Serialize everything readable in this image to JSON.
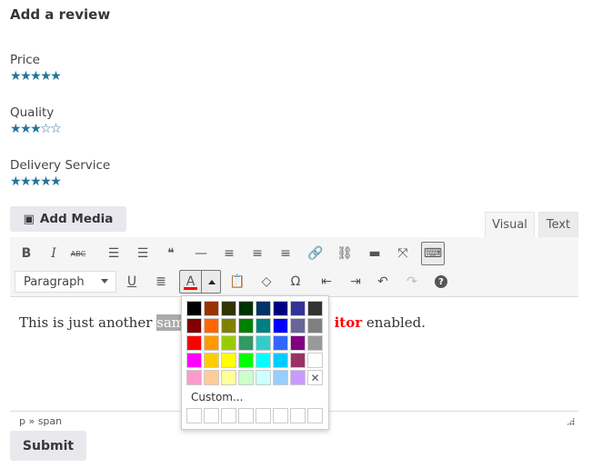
{
  "page": {
    "title": "Add a review",
    "ratings": [
      {
        "label": "Price",
        "value": 5,
        "max": 5
      },
      {
        "label": "Quality",
        "value": 3,
        "max": 5
      },
      {
        "label": "Delivery Service",
        "value": 5,
        "max": 5
      }
    ]
  },
  "editor": {
    "add_media_label": "Add Media",
    "tabs": [
      {
        "label": "Visual",
        "active": true
      },
      {
        "label": "Text",
        "active": false
      }
    ],
    "toolbar_row1": [
      {
        "name": "bold",
        "glyph": "B"
      },
      {
        "name": "italic",
        "glyph": "I"
      },
      {
        "name": "strikethrough",
        "glyph": "ABC"
      },
      {
        "name": "bullet-list",
        "glyph": "☰"
      },
      {
        "name": "numbered-list",
        "glyph": "☰"
      },
      {
        "name": "blockquote",
        "glyph": "❝"
      },
      {
        "name": "horizontal-line",
        "glyph": "—"
      },
      {
        "name": "align-left",
        "glyph": "≡"
      },
      {
        "name": "align-center",
        "glyph": "≡"
      },
      {
        "name": "align-right",
        "glyph": "≡"
      },
      {
        "name": "link",
        "glyph": "🔗"
      },
      {
        "name": "unlink",
        "glyph": "⛓"
      },
      {
        "name": "read-more",
        "glyph": "▬"
      },
      {
        "name": "fullscreen",
        "glyph": "⤧"
      },
      {
        "name": "toolbar-toggle",
        "glyph": "⌨"
      }
    ],
    "format_select": "Paragraph",
    "toolbar_row2": [
      {
        "name": "underline",
        "glyph": "U"
      },
      {
        "name": "justify",
        "glyph": "≣"
      },
      {
        "name": "paste-as-text",
        "glyph": "📋"
      },
      {
        "name": "clear-formatting",
        "glyph": "◇"
      },
      {
        "name": "special-character",
        "glyph": "Ω"
      },
      {
        "name": "outdent",
        "glyph": "⇤"
      },
      {
        "name": "indent",
        "glyph": "⇥"
      },
      {
        "name": "undo",
        "glyph": "↶"
      },
      {
        "name": "redo",
        "glyph": "↷"
      },
      {
        "name": "help",
        "glyph": "?"
      }
    ],
    "text_color_glyph": "A",
    "text_color_current": "#ff0000",
    "content": {
      "before": "This is just another ",
      "selected": "samp",
      "red_text": "itor",
      "after": " enabled."
    },
    "path": "p » span"
  },
  "color_picker": {
    "colors": [
      "#000000",
      "#993300",
      "#333300",
      "#003300",
      "#003366",
      "#000080",
      "#333399",
      "#333333",
      "#800000",
      "#ff6600",
      "#808000",
      "#008000",
      "#008080",
      "#0000ff",
      "#666699",
      "#808080",
      "#ff0000",
      "#ff9900",
      "#99cc00",
      "#339966",
      "#33cccc",
      "#3366ff",
      "#800080",
      "#999999",
      "#ff00ff",
      "#ffcc00",
      "#ffff00",
      "#00ff00",
      "#00ffff",
      "#00ccff",
      "#993366",
      "#ffffff",
      "#ff99cc",
      "#ffcc99",
      "#ffff99",
      "#ccffcc",
      "#ccffff",
      "#99ccff",
      "#cc99ff"
    ],
    "remove_glyph": "✕",
    "custom_label": "Custom...",
    "custom_slots": 8
  },
  "submit_label": "Submit"
}
